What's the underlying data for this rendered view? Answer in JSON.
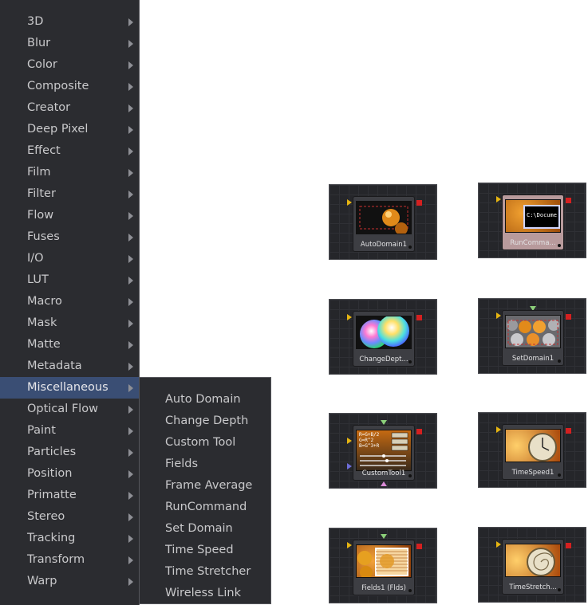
{
  "menu": {
    "items": [
      {
        "label": "3D"
      },
      {
        "label": "Blur"
      },
      {
        "label": "Color"
      },
      {
        "label": "Composite"
      },
      {
        "label": "Creator"
      },
      {
        "label": "Deep Pixel"
      },
      {
        "label": "Effect"
      },
      {
        "label": "Film"
      },
      {
        "label": "Filter"
      },
      {
        "label": "Flow"
      },
      {
        "label": "Fuses"
      },
      {
        "label": "I/O"
      },
      {
        "label": "LUT"
      },
      {
        "label": "Macro"
      },
      {
        "label": "Mask"
      },
      {
        "label": "Matte"
      },
      {
        "label": "Metadata"
      },
      {
        "label": "Miscellaneous"
      },
      {
        "label": "Optical Flow"
      },
      {
        "label": "Paint"
      },
      {
        "label": "Particles"
      },
      {
        "label": "Position"
      },
      {
        "label": "Primatte"
      },
      {
        "label": "Stereo"
      },
      {
        "label": "Tracking"
      },
      {
        "label": "Transform"
      },
      {
        "label": "Warp"
      }
    ],
    "highlighted": "Miscellaneous"
  },
  "submenu": {
    "items": [
      {
        "label": "Auto Domain"
      },
      {
        "label": "Change Depth"
      },
      {
        "label": "Custom Tool"
      },
      {
        "label": "Fields"
      },
      {
        "label": "Frame Average"
      },
      {
        "label": "RunCommand"
      },
      {
        "label": "Set Domain"
      },
      {
        "label": "Time Speed"
      },
      {
        "label": "Time Stretcher"
      },
      {
        "label": "Wireless Link"
      }
    ]
  },
  "nodes": {
    "auto_domain": {
      "label": "AutoDomain1"
    },
    "run_command": {
      "label": "RunComma...",
      "console_text": "C:\\Docume"
    },
    "change_depth": {
      "label": "ChangeDept..."
    },
    "set_domain": {
      "label": "SetDomain1"
    },
    "custom_tool": {
      "label": "CustomTool1",
      "formula_text": "R=G+B/2\nG=R^2\nB=G^3+R"
    },
    "time_speed": {
      "label": "TimeSpeed1"
    },
    "fields": {
      "label": "Fields1  (Flds)"
    },
    "time_stretcher": {
      "label": "TimeStretch..."
    }
  },
  "colors": {
    "menu_bg": "#2b2c30",
    "menu_highlight": "#3a4e74",
    "menu_text": "#c9c9cb",
    "input_yellow": "#e6b512",
    "output_red": "#d42020",
    "mask_green": "#8cd07a"
  }
}
